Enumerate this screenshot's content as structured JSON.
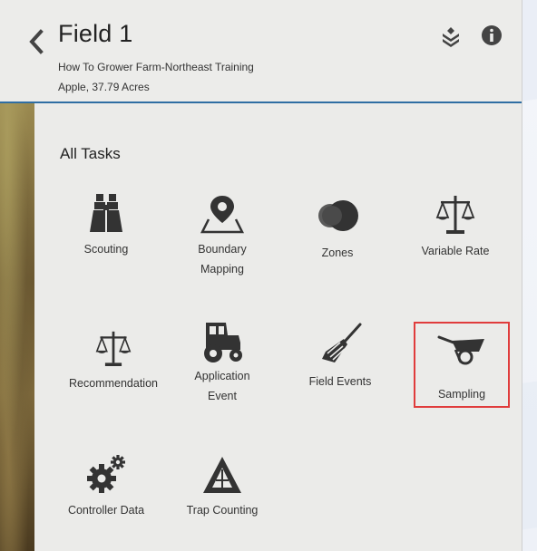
{
  "header": {
    "title": "Field 1",
    "farm": "How To Grower Farm-Northeast Training",
    "crop_info": "Apple, 37.79 Acres",
    "back_icon": "chevron-left-icon",
    "layers_icon": "layers-icon",
    "info_icon": "info-icon"
  },
  "tasks": {
    "section_title": "All Tasks",
    "items": [
      {
        "label": "Scouting",
        "icon": "binoculars-icon"
      },
      {
        "label": "Boundary\nMapping",
        "icon": "map-pin-icon"
      },
      {
        "label": "Zones",
        "icon": "zones-icon"
      },
      {
        "label": "Variable Rate",
        "icon": "scale-icon"
      },
      {
        "label": "Recommendation",
        "icon": "scale-icon"
      },
      {
        "label": "Application\nEvent",
        "icon": "tractor-icon"
      },
      {
        "label": "Field Events",
        "icon": "spatula-icon"
      },
      {
        "label": "Sampling",
        "icon": "wheelbarrow-icon"
      },
      {
        "label": "Controller Data",
        "icon": "gears-icon"
      },
      {
        "label": "Trap Counting",
        "icon": "trap-icon"
      }
    ],
    "highlighted": "Sampling"
  },
  "colors": {
    "header_border": "#2f6ea3",
    "highlight": "#e03c3c",
    "panel_bg": "#ebebe9"
  }
}
